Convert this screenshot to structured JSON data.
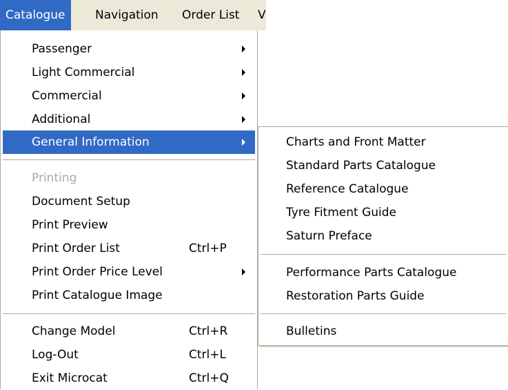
{
  "menubar": {
    "items": [
      {
        "label": "Catalogue"
      },
      {
        "label": "Navigation"
      },
      {
        "label": "Order List"
      },
      {
        "label": "V"
      }
    ]
  },
  "catalogue_menu": {
    "items": [
      {
        "label": "Passenger",
        "shortcut": "",
        "submenu": true
      },
      {
        "label": "Light Commercial",
        "shortcut": "",
        "submenu": true
      },
      {
        "label": "Commercial",
        "shortcut": "",
        "submenu": true
      },
      {
        "label": "Additional",
        "shortcut": "",
        "submenu": true
      },
      {
        "label": "General Information",
        "shortcut": "",
        "submenu": true
      },
      {
        "label": "Printing",
        "shortcut": "",
        "disabled": true
      },
      {
        "label": "Document Setup",
        "shortcut": ""
      },
      {
        "label": "Print Preview",
        "shortcut": ""
      },
      {
        "label": "Print Order List",
        "shortcut": "Ctrl+P"
      },
      {
        "label": "Print Order Price Level",
        "shortcut": "",
        "submenu": true
      },
      {
        "label": "Print Catalogue Image",
        "shortcut": ""
      },
      {
        "label": "Change Model",
        "shortcut": "Ctrl+R"
      },
      {
        "label": "Log-Out",
        "shortcut": "Ctrl+L"
      },
      {
        "label": "Exit Microcat",
        "shortcut": "Ctrl+Q"
      }
    ]
  },
  "general_information_submenu": {
    "items": [
      {
        "label": "Charts and Front Matter"
      },
      {
        "label": "Standard Parts Catalogue"
      },
      {
        "label": "Reference Catalogue"
      },
      {
        "label": "Tyre Fitment Guide"
      },
      {
        "label": "Saturn Preface"
      },
      {
        "label": "Performance Parts Catalogue"
      },
      {
        "label": "Restoration Parts Guide"
      },
      {
        "label": "Bulletins"
      }
    ]
  },
  "colors": {
    "highlight": "#316ac5",
    "menubar_bg": "#ece9d8",
    "disabled_text": "#aca899"
  }
}
